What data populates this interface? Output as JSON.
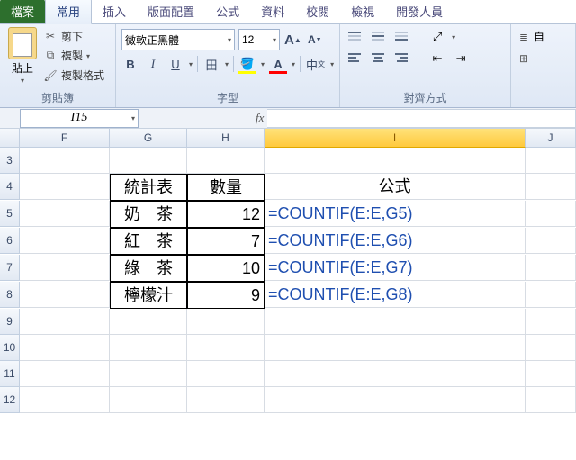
{
  "tabs": {
    "file": "檔案",
    "home": "常用",
    "insert": "插入",
    "layout": "版面配置",
    "formulas": "公式",
    "data": "資料",
    "review": "校閱",
    "view": "檢視",
    "dev": "開發人員"
  },
  "clipboard": {
    "paste": "貼上",
    "cut": "剪下",
    "copy": "複製",
    "format_painter": "複製格式",
    "group_label": "剪貼簿"
  },
  "font": {
    "name": "微軟正黑體",
    "size": "12",
    "group_label": "字型"
  },
  "align": {
    "group_label": "對齊方式",
    "wrap": "自"
  },
  "namebox": "I15",
  "fx": "fx",
  "columns": {
    "F": "F",
    "G": "G",
    "H": "H",
    "I": "I",
    "J": "J"
  },
  "rows": [
    "3",
    "4",
    "5",
    "6",
    "7",
    "8",
    "9",
    "10",
    "11",
    "12"
  ],
  "table": {
    "header_name": "統計表",
    "header_qty": "數量",
    "formula_header": "公式",
    "r1": {
      "name": "奶　茶",
      "qty": "12",
      "formula": "=COUNTIF(E:E,G5)"
    },
    "r2": {
      "name": "紅　茶",
      "qty": "7",
      "formula": "=COUNTIF(E:E,G6)"
    },
    "r3": {
      "name": "綠　茶",
      "qty": "10",
      "formula": "=COUNTIF(E:E,G7)"
    },
    "r4": {
      "name": "檸檬汁",
      "qty": "9",
      "formula": "=COUNTIF(E:E,G8)"
    }
  }
}
